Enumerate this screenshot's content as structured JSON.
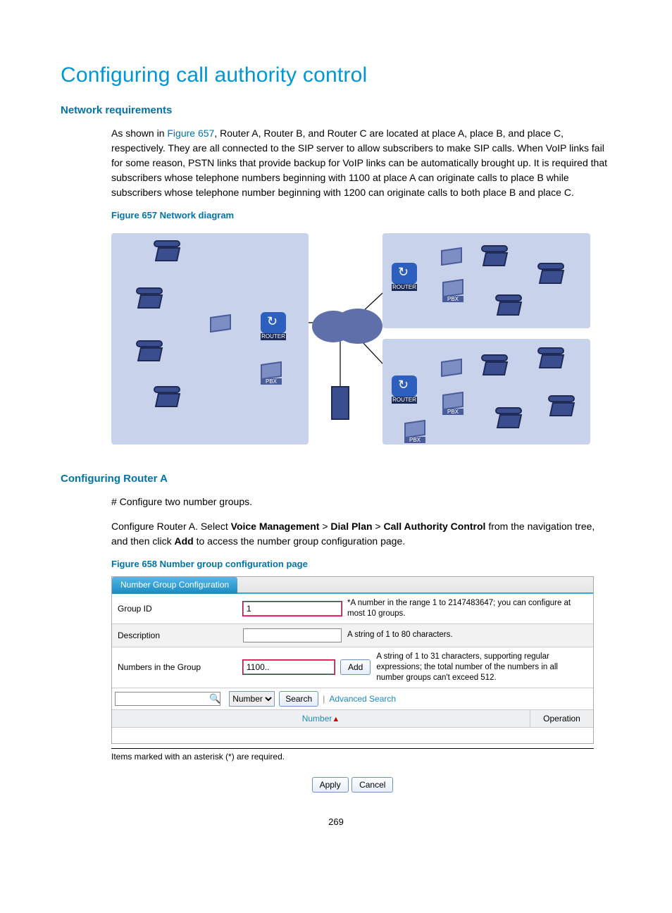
{
  "page": {
    "title": "Configuring call authority control",
    "number": "269"
  },
  "sec1": {
    "heading": "Network requirements",
    "p_pre": "As shown in ",
    "p_link": "Figure 657",
    "p_post": ", Router A, Router B, and Router C are located at place A, place B, and place C, respectively. They are all connected to the SIP server to allow subscribers to make SIP calls. When VoIP links fail for some reason, PSTN links that provide backup for VoIP links can be automatically brought up. It is required that subscribers whose telephone numbers beginning with 1100 at place A can originate calls to place B while subscribers whose telephone number beginning with 1200 can originate calls to both place B and place C.",
    "fig657": "Figure 657 Network diagram"
  },
  "sec2": {
    "heading": "Configuring Router A",
    "p1": "# Configure two number groups.",
    "p2_pre": "Configure Router A. Select ",
    "p2_b1": "Voice Management",
    "p2_s1": " > ",
    "p2_b2": "Dial Plan",
    "p2_s2": " > ",
    "p2_b3": "Call Authority Control",
    "p2_mid": " from the navigation tree, and then click ",
    "p2_b4": "Add",
    "p2_post": " to access the number group configuration page.",
    "fig658": "Figure 658 Number group configuration page"
  },
  "cfg": {
    "tab": "Number Group Configuration",
    "row1_label": "Group ID",
    "row1_value": "1",
    "row1_help": "*A number in the range 1 to 2147483647; you can configure at most 10 groups.",
    "row2_label": "Description",
    "row2_value": "",
    "row2_help": "A string of 1 to 80 characters.",
    "row3_label": "Numbers in the Group",
    "row3_value": "1100..",
    "row3_btn": "Add",
    "row3_help": "A string of 1 to 31 characters, supporting regular expressions; the total number of the numbers in all number groups can't exceed 512.",
    "search_select": "Number",
    "search_btn": "Search",
    "adv_search": "Advanced Search",
    "col1": "Number",
    "col2": "Operation",
    "footnote": "Items marked with an asterisk (*) are required.",
    "apply": "Apply",
    "cancel": "Cancel"
  }
}
